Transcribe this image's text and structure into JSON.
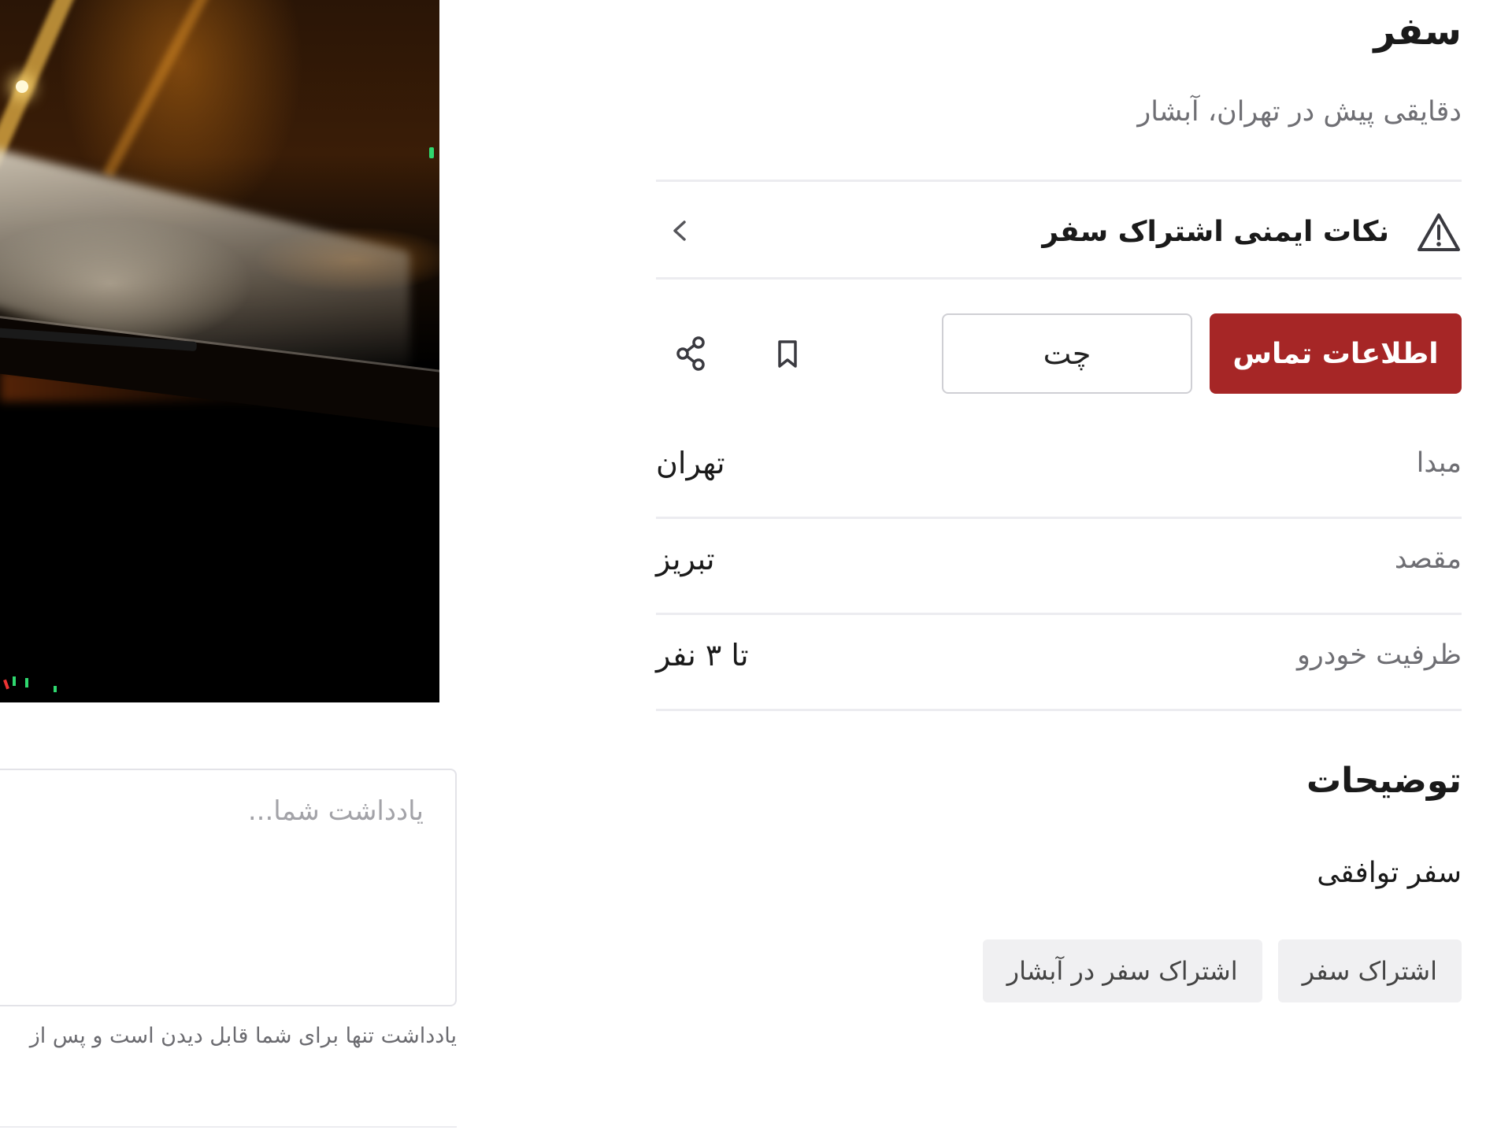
{
  "post": {
    "title": "سفر",
    "meta": "دقایقی پیش در تهران، آبشار"
  },
  "safety": {
    "label": "نکات ایمنی اشتراک سفر",
    "icon": "warning-icon"
  },
  "actions": {
    "contact_label": "اطلاعات تماس",
    "chat_label": "چت",
    "bookmark_icon": "bookmark-icon",
    "share_icon": "share-icon"
  },
  "details": [
    {
      "key": "مبدا",
      "value": "تهران"
    },
    {
      "key": "مقصد",
      "value": "تبریز"
    },
    {
      "key": "ظرفیت خودرو",
      "value": "تا ۳ نفر"
    }
  ],
  "description": {
    "title": "توضیحات",
    "text": "سفر توافقی"
  },
  "tags": [
    "اشتراک سفر",
    "اشتراک سفر در آبشار"
  ],
  "note": {
    "placeholder": "یادداشت شما...",
    "hint": "یادداشت تنها برای شما قابل دیدن است و پس از"
  },
  "colors": {
    "accent": "#a62626",
    "divider": "#ececf0",
    "muted_text": "#6f6f74"
  }
}
